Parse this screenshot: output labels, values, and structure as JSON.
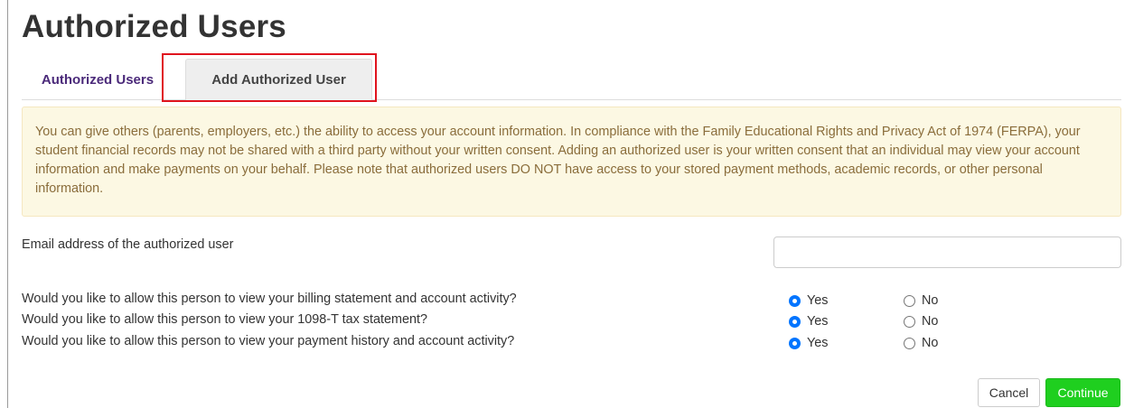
{
  "page": {
    "title": "Authorized Users"
  },
  "tabs": [
    {
      "label": "Authorized Users",
      "active": false
    },
    {
      "label": "Add Authorized User",
      "active": true
    }
  ],
  "notice": {
    "text": "You can give others (parents, employers, etc.) the ability to access your account information. In compliance with the Family Educational Rights and Privacy Act of 1974 (FERPA), your student financial records may not be shared with a third party without your written consent. Adding an authorized user is your written consent that an individual may view your account information and make payments on your behalf. Please note that authorized users DO NOT have access to your stored payment methods, academic records, or other personal information."
  },
  "form": {
    "email_label": "Email address of the authorized user",
    "email_value": "",
    "questions": [
      {
        "text": "Would you like to allow this person to view your billing statement and account activity?",
        "yes_label": "Yes",
        "no_label": "No",
        "selected": "Yes"
      },
      {
        "text": "Would you like to allow this person to view your 1098-T tax statement?",
        "yes_label": "Yes",
        "no_label": "No",
        "selected": "Yes"
      },
      {
        "text": "Would you like to allow this person to view your payment history and account activity?",
        "yes_label": "Yes",
        "no_label": "No",
        "selected": "Yes"
      }
    ]
  },
  "buttons": {
    "cancel": "Cancel",
    "continue": "Continue"
  },
  "colors": {
    "tab_link": "#4b2a7a",
    "notice_bg": "#fcf8e3",
    "notice_text": "#8a6d3b",
    "highlight_border": "#e0141e",
    "continue_bg": "#1fcf1f",
    "radio_checked": "#0075ff"
  }
}
